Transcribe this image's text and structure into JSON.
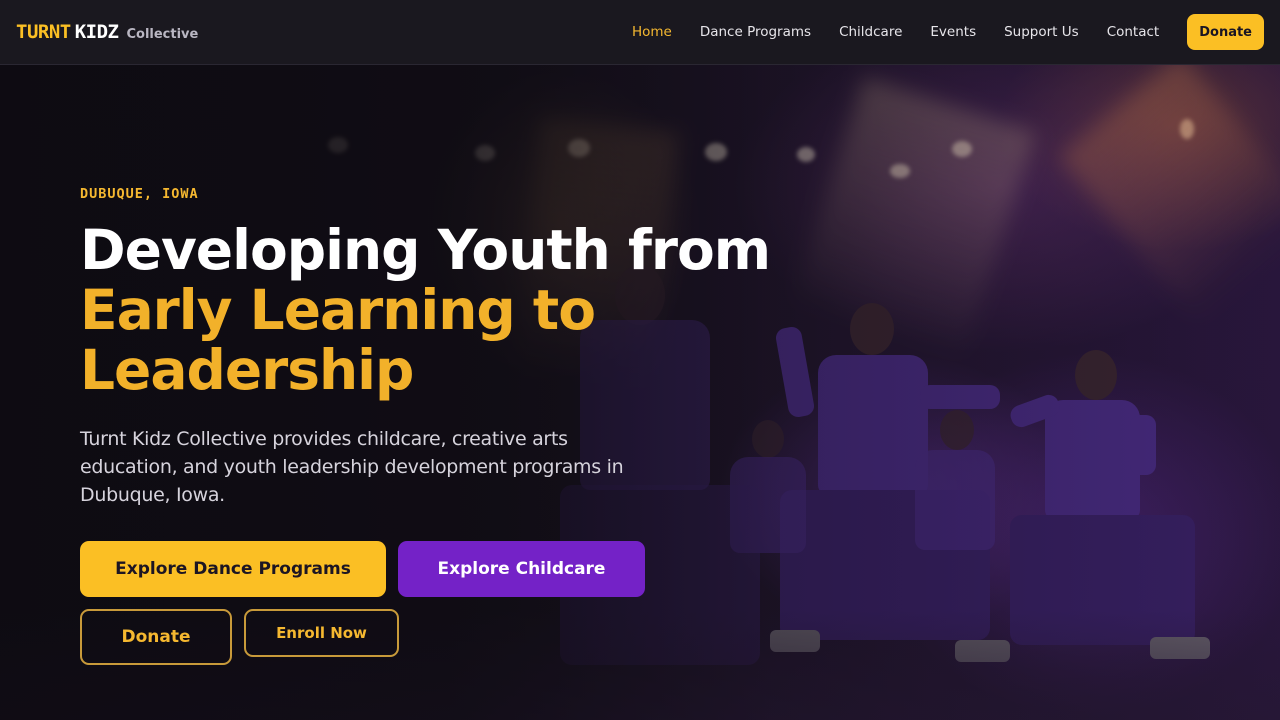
{
  "nav": {
    "brand": {
      "turnt": "TURNT",
      "kidz": "KIDZ",
      "collective": "Collective"
    },
    "links": [
      {
        "label": "Home",
        "active": true
      },
      {
        "label": "Dance Programs",
        "active": false
      },
      {
        "label": "Childcare",
        "active": false
      },
      {
        "label": "Events",
        "active": false
      },
      {
        "label": "Support Us",
        "active": false
      },
      {
        "label": "Contact",
        "active": false
      }
    ],
    "donate_label": "Donate"
  },
  "hero": {
    "eyebrow": "DUBUQUE, IOWA",
    "headline_line1": "Developing Youth from",
    "headline_line2": "Early Learning to",
    "headline_line3": "Leadership",
    "lead": "Turnt Kidz Collective provides childcare, creative arts education, and youth leadership development programs in Dubuque, Iowa.",
    "buttons": {
      "dance": "Explore Dance Programs",
      "childcare": "Explore Childcare",
      "donate": "Donate",
      "enroll": "Enroll Now"
    }
  },
  "colors": {
    "accent_gold": "#fbbf24",
    "accent_purple": "#7422c7",
    "nav_bg": "#1a181f",
    "active_link": "#f5b830"
  }
}
